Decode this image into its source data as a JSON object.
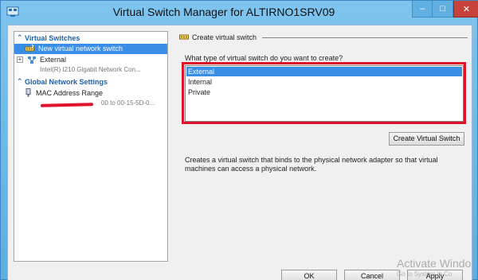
{
  "window": {
    "title": "Virtual Switch Manager for ALTIRNO1SRV09",
    "controls": {
      "minimize": "–",
      "maximize": "□",
      "close": "✕"
    }
  },
  "left_pane": {
    "virtual_switches_header": "Virtual Switches",
    "items": [
      {
        "label": "New virtual network switch",
        "icon": "network-switch-new-icon",
        "selected": true
      },
      {
        "label": "External",
        "sub": "Intel(R) I210 Gigabit Network Con...",
        "icon": "network-switch-icon",
        "expander": "+"
      }
    ],
    "global_settings_header": "Global Network Settings",
    "mac_item": {
      "label": "MAC Address Range",
      "sub": "00 to 00-15-5D-0...",
      "icon": "mac-address-icon"
    }
  },
  "right_pane": {
    "group_title": "Create virtual switch",
    "question": "What type of virtual switch do you want to create?",
    "switch_types": [
      "External",
      "Internal",
      "Private"
    ],
    "selected_type": "External",
    "create_button": "Create Virtual Switch",
    "description": "Creates a virtual switch that binds to the physical network adapter so that virtual machines can access a physical network."
  },
  "footer": {
    "ok": "OK",
    "cancel": "Cancel",
    "apply": "Apply"
  },
  "watermark": {
    "line1": "Activate Windo",
    "line2": "Go to System in Co"
  },
  "colors": {
    "selection": "#3a8ee6",
    "highlight": "#e0112b",
    "section_header": "#1f5fa8",
    "title_bar": "#6fb8e6"
  }
}
